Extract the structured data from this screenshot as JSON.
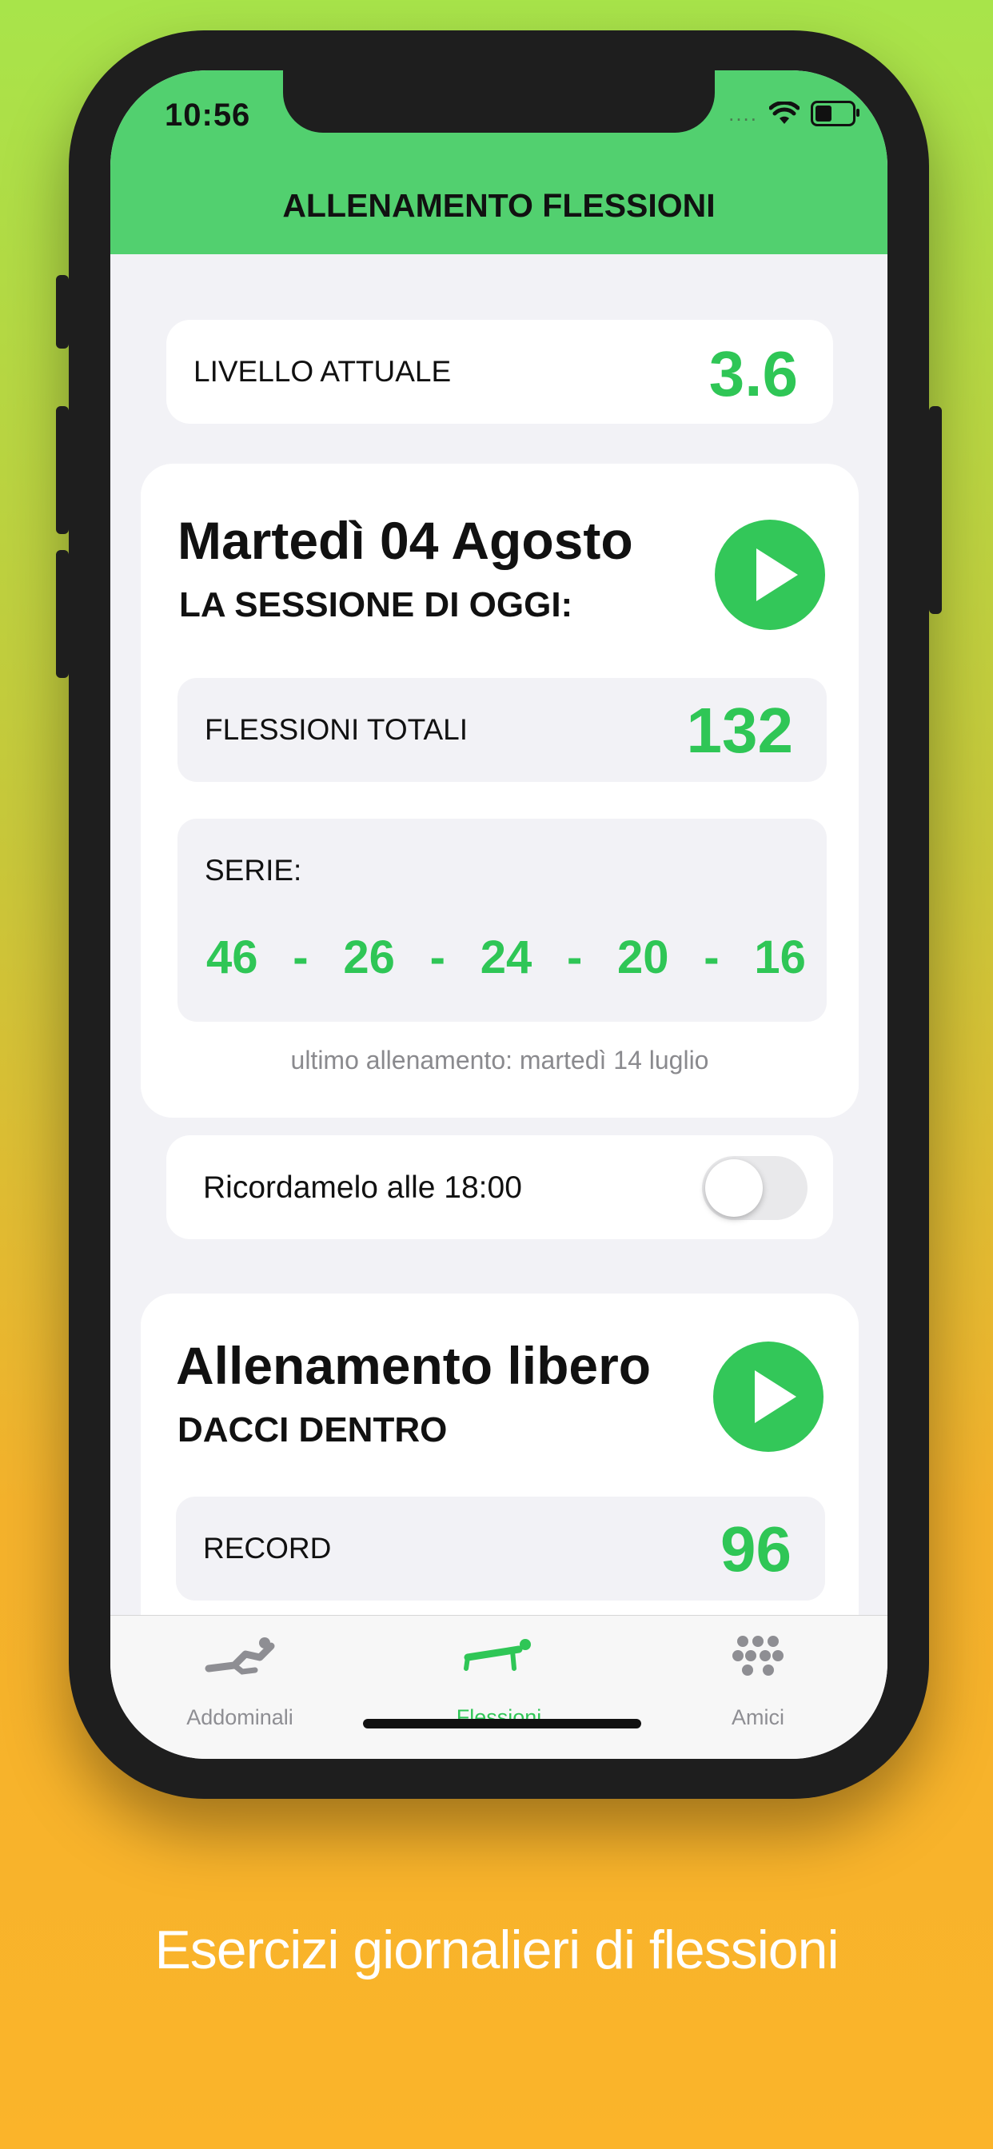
{
  "status_bar": {
    "time": "10:56",
    "signal": "....",
    "wifi_icon": "wifi-icon",
    "battery_icon": "battery-icon"
  },
  "header": {
    "title": "ALLENAMENTO FLESSIONI"
  },
  "level": {
    "label": "LIVELLO ATTUALE",
    "value": "3.6"
  },
  "session": {
    "date": "Martedì 04 Agosto",
    "subtitle": "LA SESSIONE DI OGGI:",
    "total_label": "FLESSIONI TOTALI",
    "total_value": "132",
    "series_label": "SERIE:",
    "series": [
      "46",
      "26",
      "24",
      "20",
      "16"
    ],
    "separator": "-",
    "last_workout": "ultimo allenamento: martedì 14 luglio"
  },
  "reminder": {
    "label": "Ricordamelo alle 18:00",
    "enabled": false
  },
  "free_workout": {
    "title": "Allenamento libero",
    "subtitle": "DACCI DENTRO",
    "record_label": "RECORD",
    "record_value": "96"
  },
  "tabs": [
    {
      "label": "Addominali",
      "icon": "situp-icon",
      "active": false
    },
    {
      "label": "Flessioni",
      "icon": "pushup-icon",
      "active": true
    },
    {
      "label": "Amici",
      "icon": "friends-icon",
      "active": false
    }
  ],
  "colors": {
    "accent_green": "#2fc656",
    "header_green": "#52d06f",
    "play_green": "#33c759",
    "inactive_tab": "#8e8e93"
  },
  "caption": "Esercizi giornalieri di flessioni"
}
